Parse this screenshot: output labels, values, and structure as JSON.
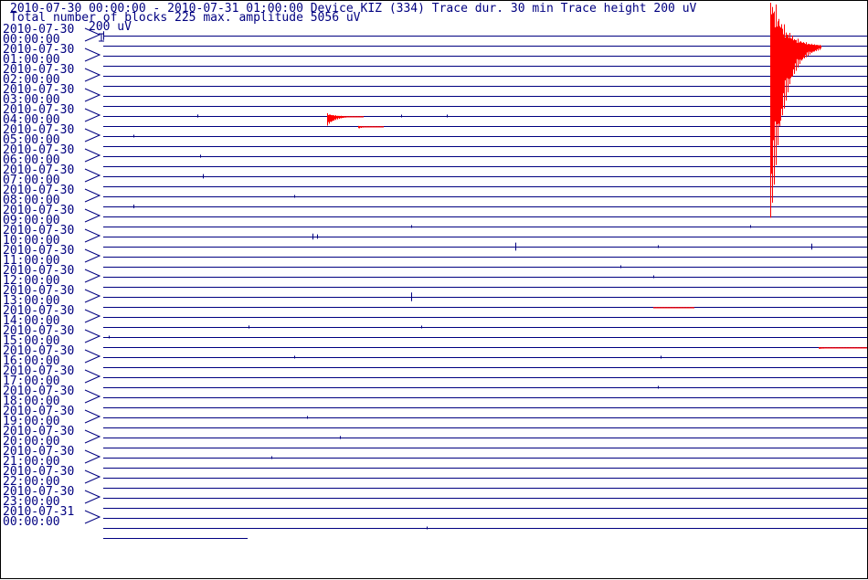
{
  "header": {
    "line1": "2010-07-30 00:00:00 - 2010-07-31 01:00:00  Device  KIZ (334)  Trace dur. 30 min  Trace height 200 uV",
    "line2": "Total number of blocks 225 max. amplitude 5056 uV",
    "scale_label": "200 uV"
  },
  "colors": {
    "trace": "#000080",
    "event": "#ff0000",
    "text": "#000080",
    "background": "#ffffff"
  },
  "chart_data": {
    "type": "line",
    "trace_duration_min": 30,
    "trace_height_uV": 200,
    "max_amplitude_uV": 5056,
    "total_blocks": 225,
    "hour_labels": [
      {
        "date": "2010-07-30",
        "time": "00:00:00"
      },
      {
        "date": "2010-07-30",
        "time": "01:00:00"
      },
      {
        "date": "2010-07-30",
        "time": "02:00:00"
      },
      {
        "date": "2010-07-30",
        "time": "03:00:00"
      },
      {
        "date": "2010-07-30",
        "time": "04:00:00"
      },
      {
        "date": "2010-07-30",
        "time": "05:00:00"
      },
      {
        "date": "2010-07-30",
        "time": "06:00:00"
      },
      {
        "date": "2010-07-30",
        "time": "07:00:00"
      },
      {
        "date": "2010-07-30",
        "time": "08:00:00"
      },
      {
        "date": "2010-07-30",
        "time": "09:00:00"
      },
      {
        "date": "2010-07-30",
        "time": "10:00:00"
      },
      {
        "date": "2010-07-30",
        "time": "11:00:00"
      },
      {
        "date": "2010-07-30",
        "time": "12:00:00"
      },
      {
        "date": "2010-07-30",
        "time": "13:00:00"
      },
      {
        "date": "2010-07-30",
        "time": "14:00:00"
      },
      {
        "date": "2010-07-30",
        "time": "15:00:00"
      },
      {
        "date": "2010-07-30",
        "time": "16:00:00"
      },
      {
        "date": "2010-07-30",
        "time": "17:00:00"
      },
      {
        "date": "2010-07-30",
        "time": "18:00:00"
      },
      {
        "date": "2010-07-30",
        "time": "19:00:00"
      },
      {
        "date": "2010-07-30",
        "time": "20:00:00"
      },
      {
        "date": "2010-07-30",
        "time": "21:00:00"
      },
      {
        "date": "2010-07-30",
        "time": "22:00:00"
      },
      {
        "date": "2010-07-30",
        "time": "23:00:00"
      },
      {
        "date": "2010-07-31",
        "time": "00:00:00"
      }
    ],
    "traces_count": 50,
    "events": [
      {
        "trace": 1,
        "minute": 26.2,
        "amplitude_uV": 5056,
        "duration_min": 2.0,
        "color": "event"
      },
      {
        "trace": 8,
        "minute": 8.8,
        "amplitude_uV": 250,
        "duration_min": 1.4,
        "color": "event"
      },
      {
        "trace": 9,
        "minute": 10.0,
        "amplitude_uV": 60,
        "duration_min": 1.0,
        "color": "event"
      },
      {
        "trace": 27,
        "minute": 21.6,
        "amplitude_uV": 15,
        "duration_min": 1.6,
        "color": "event"
      },
      {
        "trace": 31,
        "minute": 28.1,
        "amplitude_uV": 40,
        "duration_min": 1.9,
        "color": "event"
      }
    ],
    "spikes": [
      {
        "trace": 0,
        "minute": 0.0,
        "amplitude_uV": 120
      },
      {
        "trace": 8,
        "minute": 3.7,
        "amplitude_uV": 40
      },
      {
        "trace": 8,
        "minute": 11.7,
        "amplitude_uV": 30
      },
      {
        "trace": 8,
        "minute": 13.5,
        "amplitude_uV": 25
      },
      {
        "trace": 10,
        "minute": 1.2,
        "amplitude_uV": 30
      },
      {
        "trace": 12,
        "minute": 3.8,
        "amplitude_uV": 40
      },
      {
        "trace": 14,
        "minute": 3.9,
        "amplitude_uV": 60
      },
      {
        "trace": 16,
        "minute": 7.5,
        "amplitude_uV": 25
      },
      {
        "trace": 17,
        "minute": 1.2,
        "amplitude_uV": 50
      },
      {
        "trace": 19,
        "minute": 12.1,
        "amplitude_uV": 30
      },
      {
        "trace": 19,
        "minute": 25.4,
        "amplitude_uV": 20
      },
      {
        "trace": 20,
        "minute": 8.2,
        "amplitude_uV": 80
      },
      {
        "trace": 20,
        "minute": 8.4,
        "amplitude_uV": 60
      },
      {
        "trace": 21,
        "minute": 16.2,
        "amplitude_uV": 110
      },
      {
        "trace": 21,
        "minute": 21.8,
        "amplitude_uV": 30
      },
      {
        "trace": 21,
        "minute": 27.8,
        "amplitude_uV": 80
      },
      {
        "trace": 23,
        "minute": 20.3,
        "amplitude_uV": 30
      },
      {
        "trace": 24,
        "minute": 21.6,
        "amplitude_uV": 30
      },
      {
        "trace": 26,
        "minute": 12.1,
        "amplitude_uV": 120
      },
      {
        "trace": 29,
        "minute": 5.7,
        "amplitude_uV": 40
      },
      {
        "trace": 29,
        "minute": 12.5,
        "amplitude_uV": 20
      },
      {
        "trace": 30,
        "minute": 0.2,
        "amplitude_uV": 20
      },
      {
        "trace": 32,
        "minute": 7.5,
        "amplitude_uV": 30
      },
      {
        "trace": 32,
        "minute": 21.9,
        "amplitude_uV": 30
      },
      {
        "trace": 35,
        "minute": 21.8,
        "amplitude_uV": 25
      },
      {
        "trace": 38,
        "minute": 8.0,
        "amplitude_uV": 30
      },
      {
        "trace": 40,
        "minute": 9.3,
        "amplitude_uV": 40
      },
      {
        "trace": 42,
        "minute": 6.6,
        "amplitude_uV": 25
      },
      {
        "trace": 49,
        "minute": 12.7,
        "amplitude_uV": 20
      }
    ]
  }
}
